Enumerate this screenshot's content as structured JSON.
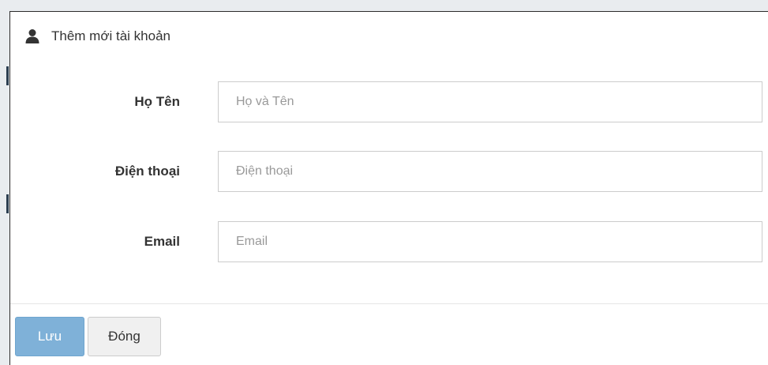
{
  "modal": {
    "title": "Thêm mới tài khoản",
    "header_icon": "user-icon"
  },
  "form": {
    "fields": [
      {
        "label": "Họ Tên",
        "placeholder": "Họ và Tên",
        "value": ""
      },
      {
        "label": "Điện thoại",
        "placeholder": "Điện thoại",
        "value": ""
      },
      {
        "label": "Email",
        "placeholder": "Email",
        "value": ""
      }
    ]
  },
  "footer": {
    "save_label": "Lưu",
    "close_label": "Đóng"
  },
  "colors": {
    "primary_button": "#7fb1d8",
    "default_button": "#f0f0f0",
    "text": "#333333",
    "border": "#cccccc"
  }
}
